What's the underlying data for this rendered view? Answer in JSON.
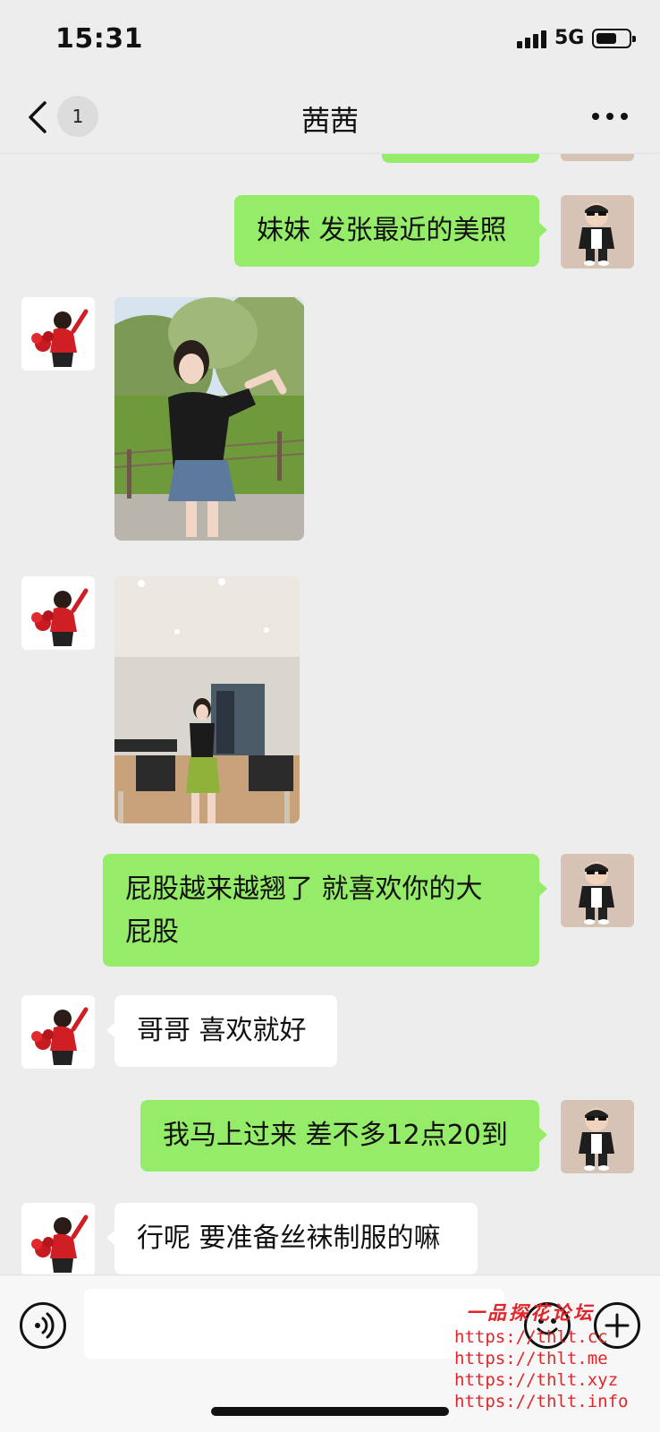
{
  "status_bar": {
    "time": "15:31",
    "network": "5G"
  },
  "nav": {
    "unread_count": "1",
    "title": "茜茜"
  },
  "messages": [
    {
      "from": "me",
      "type": "text",
      "text": "妹妹 发张最近的美照"
    },
    {
      "from": "contact",
      "type": "image",
      "description": "photo-park"
    },
    {
      "from": "contact",
      "type": "image",
      "description": "photo-gym"
    },
    {
      "from": "me",
      "type": "text",
      "text_line1": "屁股越来越翘了 就喜欢你的大",
      "text_line2": "屁股"
    },
    {
      "from": "contact",
      "type": "text",
      "text": "哥哥 喜欢就好"
    },
    {
      "from": "me",
      "type": "text",
      "text": "我马上过来 差不多12点20到"
    },
    {
      "from": "contact",
      "type": "text",
      "text": "行呢 要准备丝袜制服的嘛"
    }
  ],
  "input_bar": {
    "voice_icon": "voice-icon",
    "emoji_icon": "emoji-icon",
    "plus_icon": "plus-icon",
    "placeholder": ""
  },
  "watermark": {
    "title": "一品探花论坛",
    "urls": [
      "https://thlt.cc",
      "https://thlt.me",
      "https://thlt.xyz",
      "https://thlt.info"
    ]
  },
  "colors": {
    "background": "#ededed",
    "bubble_self": "#95ec69",
    "bubble_other": "#ffffff",
    "watermark": "#e0262a"
  }
}
